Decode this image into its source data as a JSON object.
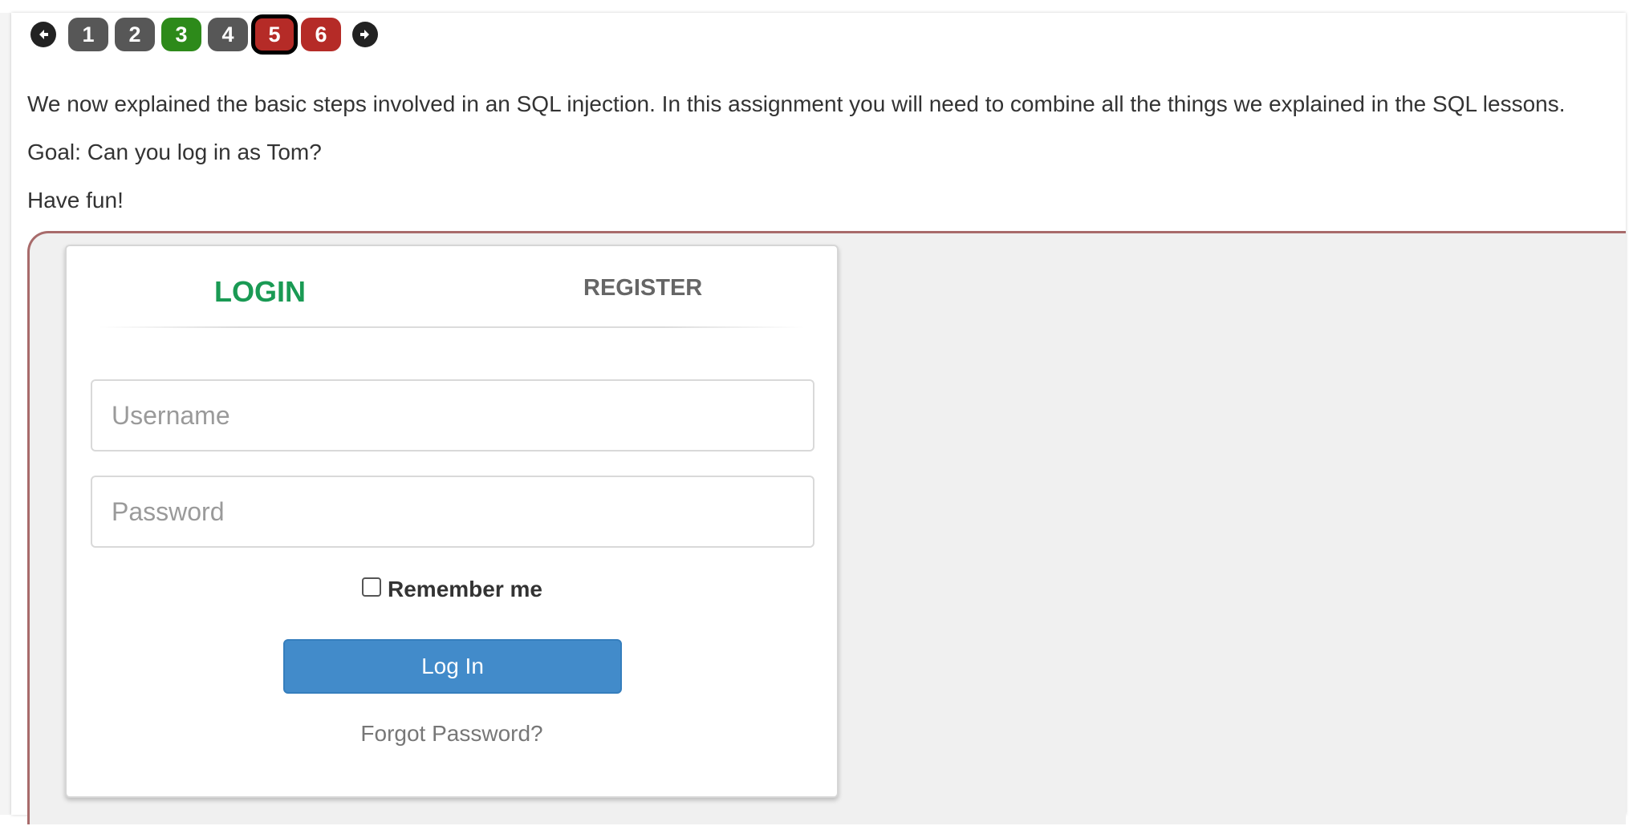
{
  "navigation": {
    "prev_icon": "arrow-left-icon",
    "next_icon": "arrow-right-icon",
    "pages": [
      {
        "label": "1",
        "status": "grey"
      },
      {
        "label": "2",
        "status": "grey"
      },
      {
        "label": "3",
        "status": "green"
      },
      {
        "label": "4",
        "status": "grey"
      },
      {
        "label": "5",
        "status": "red",
        "current": true
      },
      {
        "label": "6",
        "status": "red"
      }
    ]
  },
  "lesson": {
    "intro": "We now explained the basic steps involved in an SQL injection. In this assignment you will need to combine all the things we explained in the SQL lessons.",
    "goal": "Goal: Can you log in as Tom?",
    "closing": "Have fun!"
  },
  "login_form": {
    "tab_login": "LOGIN",
    "tab_register": "REGISTER",
    "username_placeholder": "Username",
    "username_value": "",
    "password_placeholder": "Password",
    "password_value": "",
    "remember_label": "Remember me",
    "remember_checked": false,
    "submit_label": "Log In",
    "forgot_label": "Forgot Password?"
  },
  "colors": {
    "login_tab": "#1a9a54",
    "button": "#428bca",
    "page_grey": "#575757",
    "page_green": "#2d8a1a",
    "page_red": "#b52b27",
    "frame_border": "#a86b6b"
  }
}
